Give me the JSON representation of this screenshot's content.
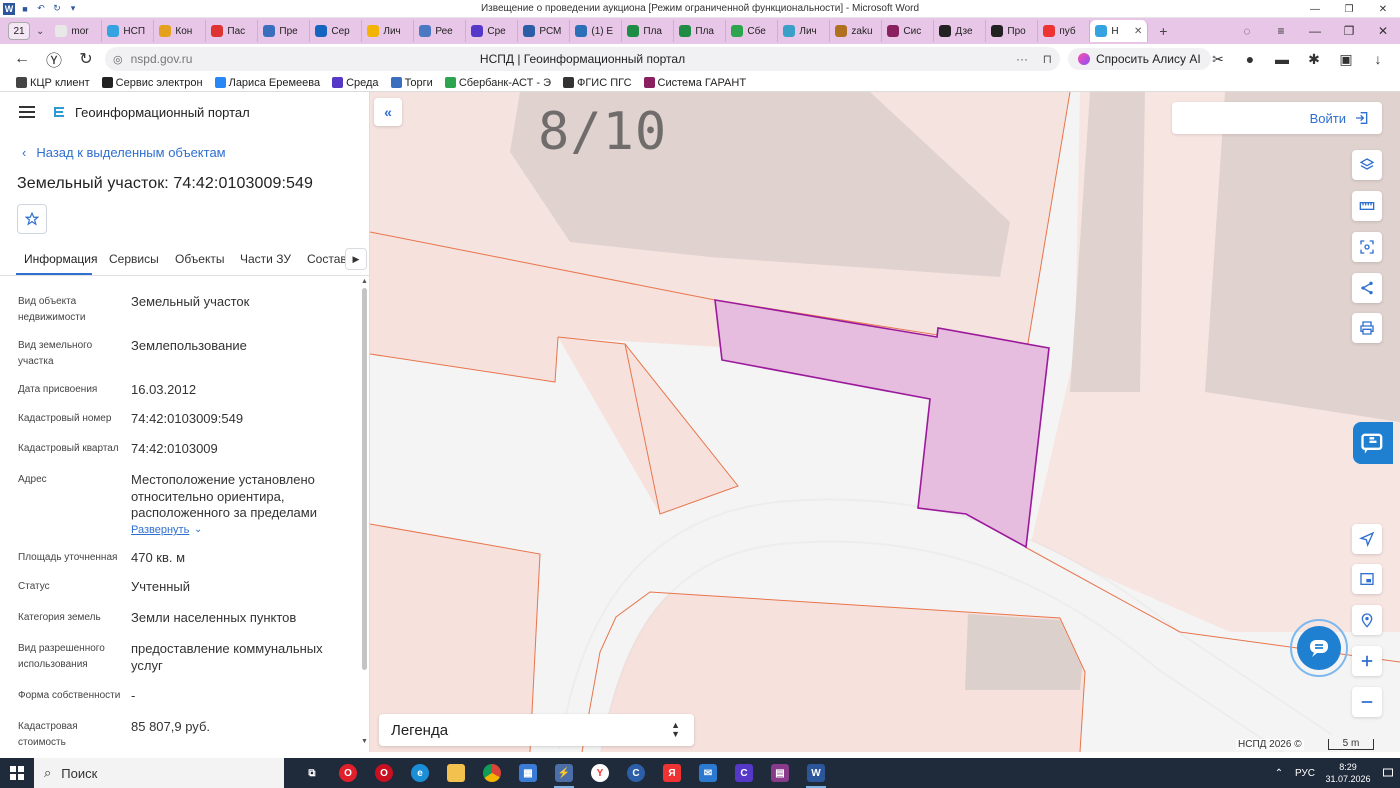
{
  "word": {
    "title": "Извещение о проведении аукциона [Режим ограниченной функциональности] - Microsoft Word",
    "logo": "W"
  },
  "browser": {
    "tab_count": "21",
    "tabs": [
      {
        "label": "mor",
        "fav_color": "#e8e8e8"
      },
      {
        "label": "НСП",
        "fav_color": "#35a3e0"
      },
      {
        "label": "Кон",
        "fav_color": "#e5a020"
      },
      {
        "label": "Пас",
        "fav_color": "#d33"
      },
      {
        "label": "Пре",
        "fav_color": "#3a6fbf"
      },
      {
        "label": "Сер",
        "fav_color": "#1565c0"
      },
      {
        "label": "Лич",
        "fav_color": "#f2b400"
      },
      {
        "label": "Рее",
        "fav_color": "#4a78c2"
      },
      {
        "label": "Сре",
        "fav_color": "#5538c8"
      },
      {
        "label": "РСМ",
        "fav_color": "#2c5ea8"
      },
      {
        "label": "(1) E",
        "fav_color": "#2a6fb8"
      },
      {
        "label": "Пла",
        "fav_color": "#1e8c45"
      },
      {
        "label": "Пла",
        "fav_color": "#1e8c45"
      },
      {
        "label": "Сбе",
        "fav_color": "#2da44e"
      },
      {
        "label": "Лич",
        "fav_color": "#3aa0c8"
      },
      {
        "label": "zaku",
        "fav_color": "#b07020"
      },
      {
        "label": "Сис",
        "fav_color": "#8a2060"
      },
      {
        "label": "Дзе",
        "fav_color": "#222"
      },
      {
        "label": "Про",
        "fav_color": "#222"
      },
      {
        "label": "пуб",
        "fav_color": "#e33"
      },
      {
        "label": "Н",
        "fav_color": "#35a3e0",
        "active": true
      }
    ],
    "url": "nspd.gov.ru",
    "page_title": "НСПД | Геоинформационный портал",
    "alice_label": "Спросить Алису AI",
    "bookmarks": [
      {
        "label": "КЦР клиент",
        "color": "#444"
      },
      {
        "label": "Сервис электрон",
        "color": "#222"
      },
      {
        "label": "Лариса Еремеева",
        "color": "#2787f5"
      },
      {
        "label": "Среда",
        "color": "#5538c8"
      },
      {
        "label": "Торги",
        "color": "#3a6fbf"
      },
      {
        "label": "Сбербанк-АСТ - Э",
        "color": "#2da44e"
      },
      {
        "label": "ФГИС ПГС",
        "color": "#333"
      },
      {
        "label": "Система ГАРАНТ",
        "color": "#8a2060"
      }
    ]
  },
  "panel": {
    "portal_name": "Геоинформационный портал",
    "back_label": "Назад к выделенным объектам",
    "title": "Земельный участок: 74:42:0103009:549",
    "tabs": [
      "Информация",
      "Сервисы",
      "Объекты",
      "Части ЗУ",
      "Состав"
    ],
    "fields": [
      {
        "label": "Вид объекта недвижимости",
        "value": "Земельный участок"
      },
      {
        "label": "Вид земельного участка",
        "value": "Землепользование"
      },
      {
        "label": "Дата присвоения",
        "value": "16.03.2012"
      },
      {
        "label": "Кадастровый номер",
        "value": "74:42:0103009:549"
      },
      {
        "label": "Кадастровый квартал",
        "value": "74:42:0103009"
      },
      {
        "label": "Адрес",
        "value": "Местоположение установлено относительно ориентира, расположенного за пределами"
      },
      {
        "label": "Площадь уточненная",
        "value": "470 кв. м"
      },
      {
        "label": "Статус",
        "value": "Учтенный"
      },
      {
        "label": "Категория земель",
        "value": "Земли населенных пунктов"
      },
      {
        "label": "Вид разрешенного использования",
        "value": "предоставление коммунальных услуг"
      },
      {
        "label": "Форма собственности",
        "value": "-"
      },
      {
        "label": "Кадастровая стоимость",
        "value": "85 807,9 руб."
      }
    ],
    "expand_label": "Развернуть"
  },
  "map": {
    "label": "8/10",
    "login_label": "Войти",
    "legend_label": "Легенда",
    "attribution": "НСПД 2026 ©",
    "scale_label": "5 m",
    "parcel_fill": "#e6bcdf",
    "parcel_stroke": "#9b1a9b",
    "boundary_color": "#e8754c"
  },
  "taskbar": {
    "search_label": "Поиск",
    "lang": "РУС",
    "time": "8:29",
    "date": "31.07.2026"
  }
}
